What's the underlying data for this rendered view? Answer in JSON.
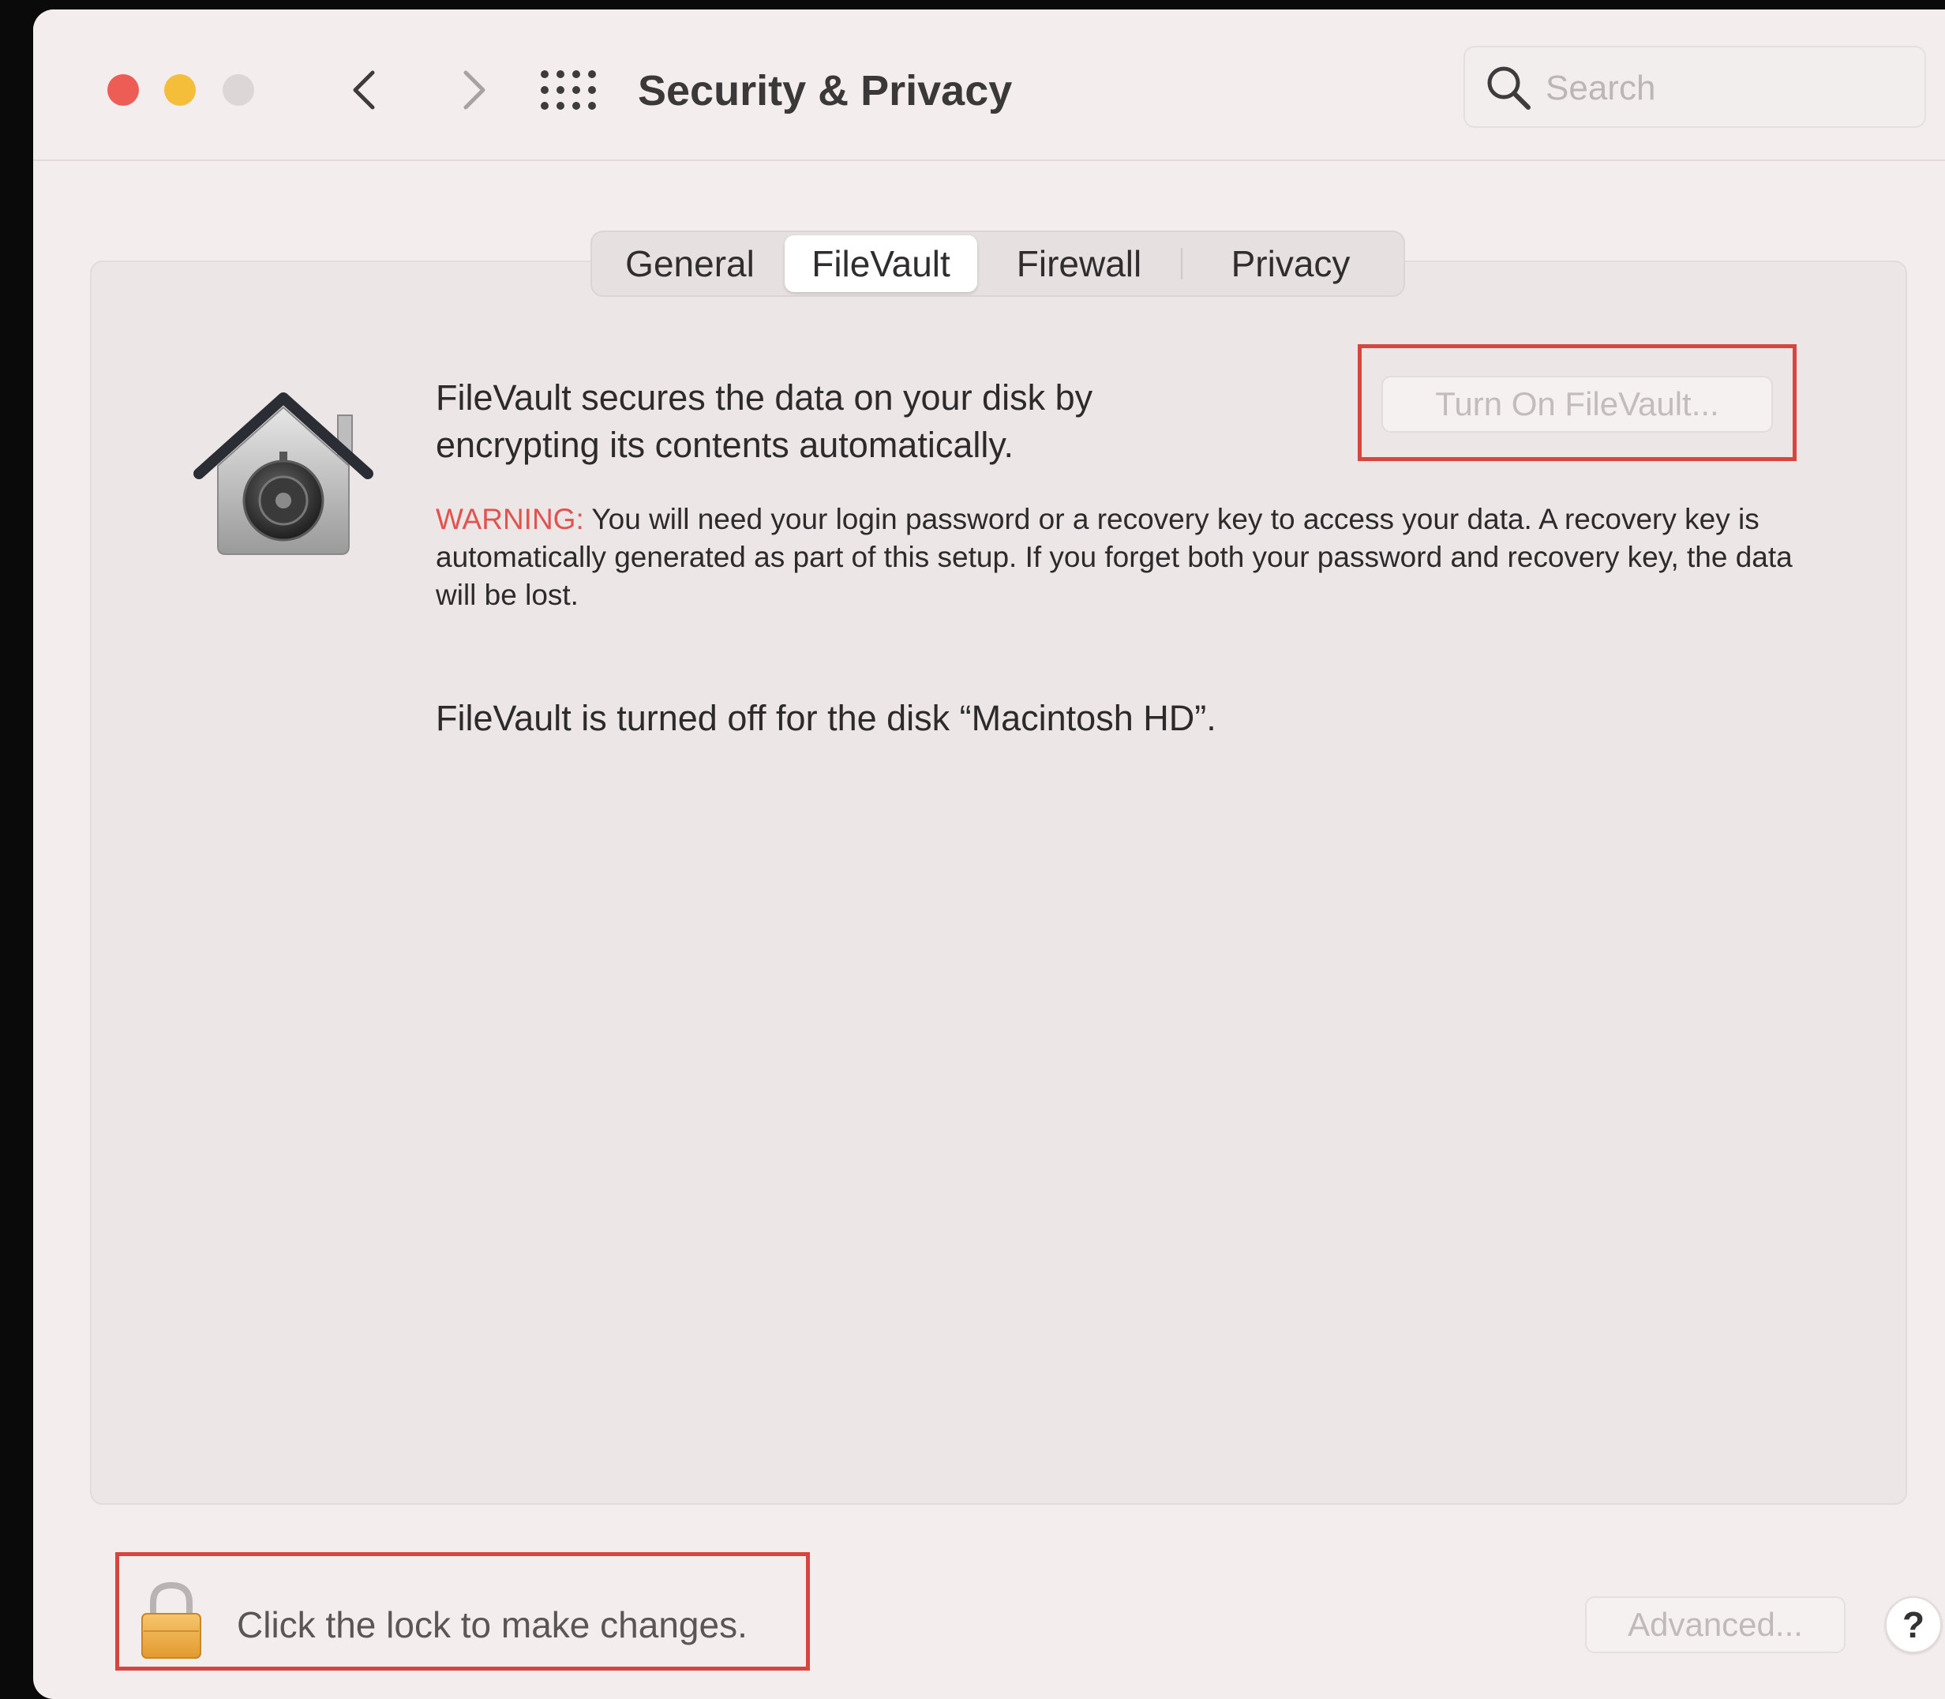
{
  "window": {
    "title": "Security & Privacy",
    "traffic_lights": {
      "close": "#ee5c56",
      "minimize": "#f4be3a",
      "zoom": "#dcd6d6"
    }
  },
  "search": {
    "placeholder": "Search"
  },
  "tabs": [
    {
      "label": "General",
      "active": false
    },
    {
      "label": "FileVault",
      "active": true
    },
    {
      "label": "Firewall",
      "active": false
    },
    {
      "label": "Privacy",
      "active": false
    }
  ],
  "filevault": {
    "icon": "filevault-house-safe-icon",
    "description": "FileVault secures the data on your disk by encrypting its contents automatically.",
    "turn_on_label": "Turn On FileVault...",
    "warning_label": "WARNING:",
    "warning_text": " You will need your login password or a recovery key to access your data. A recovery key is automatically generated as part of this setup. If you forget both your password and recovery key, the data will be lost.",
    "status": "FileVault is turned off for the disk “Macintosh HD”."
  },
  "footer": {
    "lock_text": "Click the lock to make changes.",
    "advanced_label": "Advanced...",
    "help_label": "?"
  },
  "colors": {
    "highlight_box": "#d6453f",
    "warning": "#e0534e"
  }
}
